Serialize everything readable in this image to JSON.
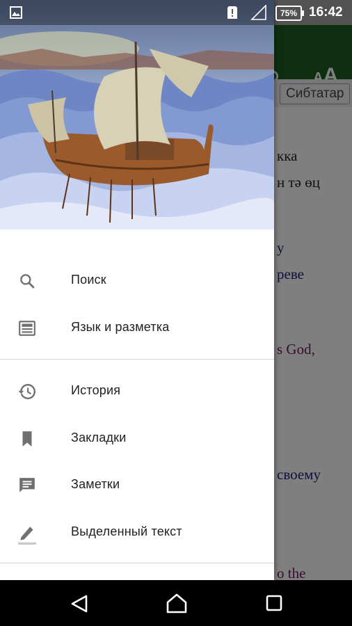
{
  "status_bar": {
    "battery": "75%",
    "time": "16:42",
    "icons": [
      "image-icon",
      "alert-icon",
      "signal-icon",
      "battery-icon"
    ]
  },
  "app_toolbar": {
    "font_size_label": "A"
  },
  "background_app": {
    "tab_chip": "Сибтатар",
    "visible_text": [
      "кка",
      "н тә өц",
      "у",
      "реве",
      "s God,",
      "своему",
      "o the"
    ]
  },
  "drawer": {
    "menu_groups": [
      [
        {
          "icon": "search-icon",
          "label": "Поиск"
        },
        {
          "icon": "layout-icon",
          "label": "Язык и разметка"
        }
      ],
      [
        {
          "icon": "history-icon",
          "label": "История"
        },
        {
          "icon": "bookmark-icon",
          "label": "Закладки"
        },
        {
          "icon": "notes-icon",
          "label": "Заметки"
        },
        {
          "icon": "highlight-icon",
          "label": "Выделенный текст"
        }
      ]
    ]
  },
  "colors": {
    "toolbar": "#1b5e20",
    "drawer_bg": "#ffffff",
    "icon_gray": "#707070",
    "text": "#212121"
  }
}
